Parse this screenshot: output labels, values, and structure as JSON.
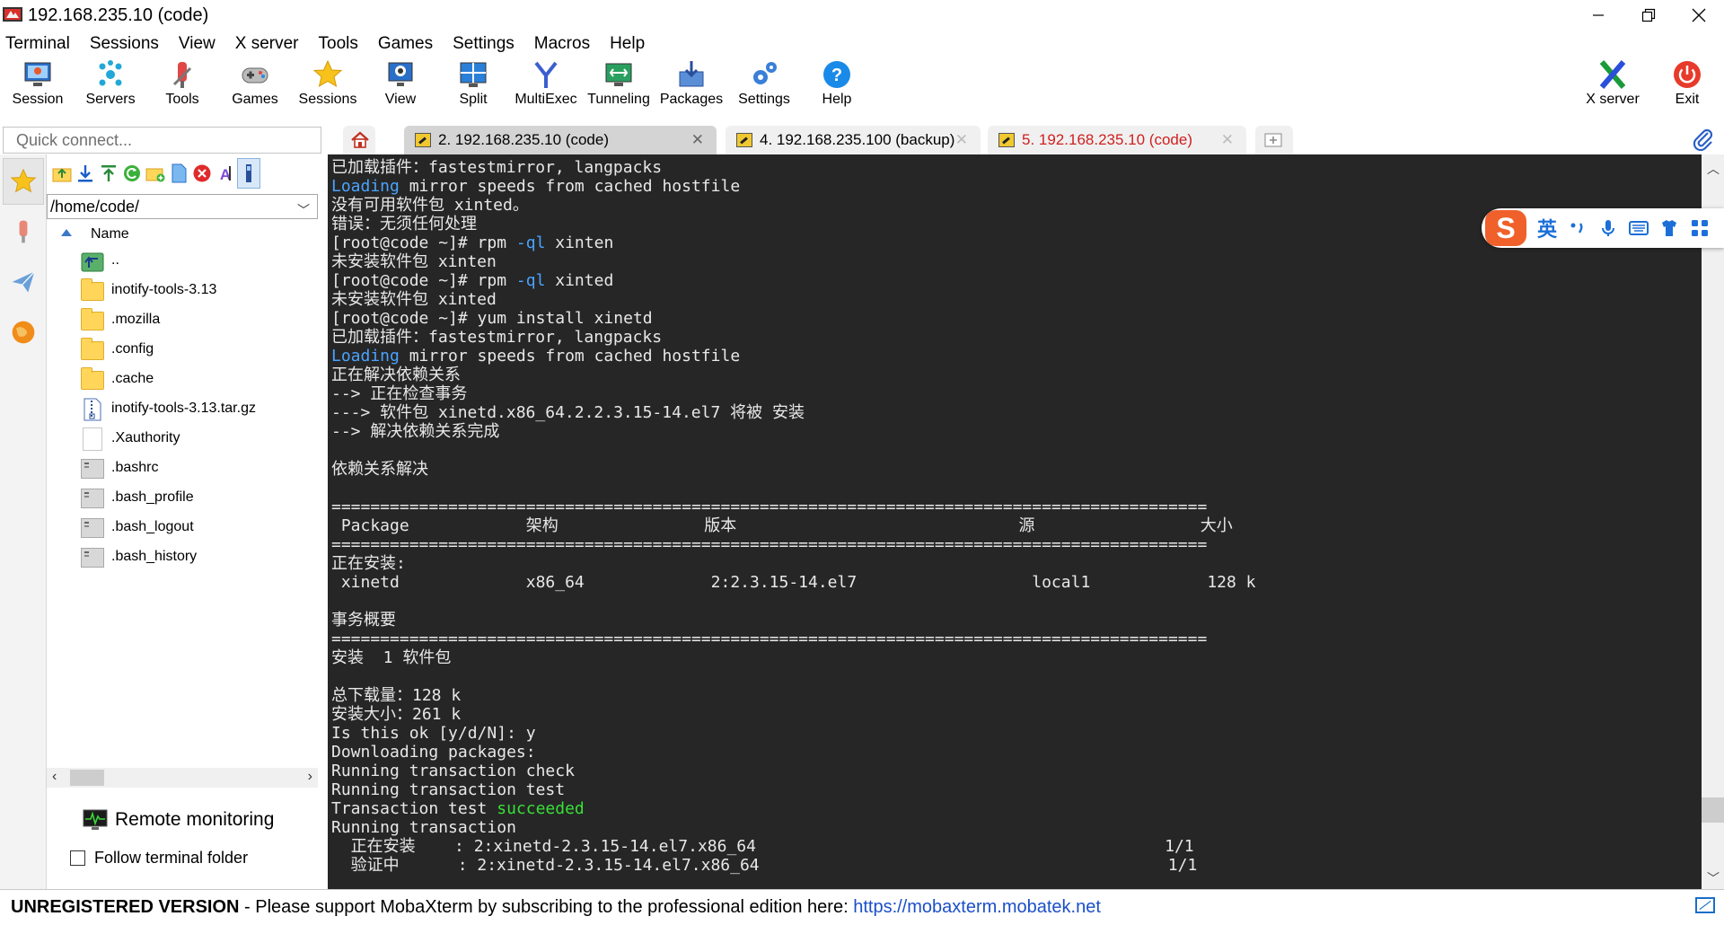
{
  "window": {
    "title": "192.168.235.10 (code)"
  },
  "menu": [
    "Terminal",
    "Sessions",
    "View",
    "X server",
    "Tools",
    "Games",
    "Settings",
    "Macros",
    "Help"
  ],
  "toolbar": {
    "session": "Session",
    "servers": "Servers",
    "tools": "Tools",
    "games": "Games",
    "sessions": "Sessions",
    "view": "View",
    "split": "Split",
    "multiexec": "MultiExec",
    "tunneling": "Tunneling",
    "packages": "Packages",
    "settings": "Settings",
    "help": "Help",
    "xserver": "X server",
    "exit": "Exit"
  },
  "quick_connect": {
    "placeholder": "Quick connect..."
  },
  "tabs": [
    {
      "label": "2. 192.168.235.10 (code)",
      "active": true
    },
    {
      "label": "4. 192.168.235.100 (backup)",
      "active": false
    },
    {
      "label": "5. 192.168.235.10 (code)",
      "active": false,
      "color": "#d02020"
    }
  ],
  "file_browser": {
    "path": "/home/code/",
    "column_name": "Name",
    "files": [
      {
        "name": "..",
        "kind": "up"
      },
      {
        "name": "inotify-tools-3.13",
        "kind": "folder"
      },
      {
        "name": ".mozilla",
        "kind": "folder"
      },
      {
        "name": ".config",
        "kind": "folder"
      },
      {
        "name": ".cache",
        "kind": "folder"
      },
      {
        "name": "inotify-tools-3.13.tar.gz",
        "kind": "archive"
      },
      {
        "name": ".Xauthority",
        "kind": "file"
      },
      {
        "name": ".bashrc",
        "kind": "terminal"
      },
      {
        "name": ".bash_profile",
        "kind": "terminal"
      },
      {
        "name": ".bash_logout",
        "kind": "terminal"
      },
      {
        "name": ".bash_history",
        "kind": "terminal"
      }
    ],
    "remote_monitoring": "Remote monitoring",
    "follow_terminal": "Follow terminal folder"
  },
  "terminal": {
    "lines": [
      [
        {
          "t": "已加载插件：fastestmirror, langpacks"
        }
      ],
      [
        {
          "t": "Loading",
          "c": "blue"
        },
        {
          "t": " mirror speeds from cached hostfile"
        }
      ],
      [
        {
          "t": "没有可用软件包 xinted。"
        }
      ],
      [
        {
          "t": "错误：无须任何处理"
        }
      ],
      [
        {
          "t": "[root@code ~]# rpm "
        },
        {
          "t": "-ql",
          "c": "blue"
        },
        {
          "t": " xinten"
        }
      ],
      [
        {
          "t": "未安装软件包 xinten"
        }
      ],
      [
        {
          "t": "[root@code ~]# rpm "
        },
        {
          "t": "-ql",
          "c": "blue"
        },
        {
          "t": " xinted"
        }
      ],
      [
        {
          "t": "未安装软件包 xinted"
        }
      ],
      [
        {
          "t": "[root@code ~]# yum install xinetd"
        }
      ],
      [
        {
          "t": "已加载插件：fastestmirror, langpacks"
        }
      ],
      [
        {
          "t": "Loading",
          "c": "blue"
        },
        {
          "t": " mirror speeds from cached hostfile"
        }
      ],
      [
        {
          "t": "正在解决依赖关系"
        }
      ],
      [
        {
          "t": "--> 正在检查事务"
        }
      ],
      [
        {
          "t": "---> 软件包 xinetd.x86_64.2.2.3.15-14.el7 将被 安装"
        }
      ],
      [
        {
          "t": "--> 解决依赖关系完成"
        }
      ],
      [
        {
          "t": ""
        }
      ],
      [
        {
          "t": "依赖关系解决"
        }
      ],
      [
        {
          "t": ""
        }
      ],
      [
        {
          "t": "=========================================================================================="
        }
      ],
      [
        {
          "t": " Package            架构               版本                             源                 大小"
        }
      ],
      [
        {
          "t": "=========================================================================================="
        }
      ],
      [
        {
          "t": "正在安装:"
        }
      ],
      [
        {
          "t": " xinetd             x86_64             2:2.3.15-14.el7                  local1            128 k"
        }
      ],
      [
        {
          "t": ""
        }
      ],
      [
        {
          "t": "事务概要"
        }
      ],
      [
        {
          "t": "=========================================================================================="
        }
      ],
      [
        {
          "t": "安装  1 软件包"
        }
      ],
      [
        {
          "t": ""
        }
      ],
      [
        {
          "t": "总下载量：128 k"
        }
      ],
      [
        {
          "t": "安装大小：261 k"
        }
      ],
      [
        {
          "t": "Is this ok [y/d/N]: y"
        }
      ],
      [
        {
          "t": "Downloading packages:"
        }
      ],
      [
        {
          "t": "Running transaction check"
        }
      ],
      [
        {
          "t": "Running transaction test"
        }
      ],
      [
        {
          "t": "Transaction test "
        },
        {
          "t": "succeeded",
          "c": "green"
        }
      ],
      [
        {
          "t": "Running transaction"
        }
      ],
      [
        {
          "t": "  正在安装    : 2:xinetd-2.3.15-14.el7.x86_64                                          1/1"
        }
      ],
      [
        {
          "t": "  验证中      : 2:xinetd-2.3.15-14.el7.x86_64                                          1/1"
        }
      ]
    ]
  },
  "ime": {
    "logo": "S",
    "lang": "英"
  },
  "status": {
    "unregistered": "UNREGISTERED VERSION",
    "separator": " - ",
    "message": "Please support MobaXterm by subscribing to the professional edition here: ",
    "link": "https://mobaxterm.mobatek.net"
  },
  "colors": {
    "terminal_bg": "#262626",
    "terminal_fg": "#e8e8e8",
    "terminal_blue": "#4aa3ff",
    "terminal_green": "#38e038",
    "tab_active": "#d4d4d4",
    "tab_inactive": "#f0f0f0"
  }
}
